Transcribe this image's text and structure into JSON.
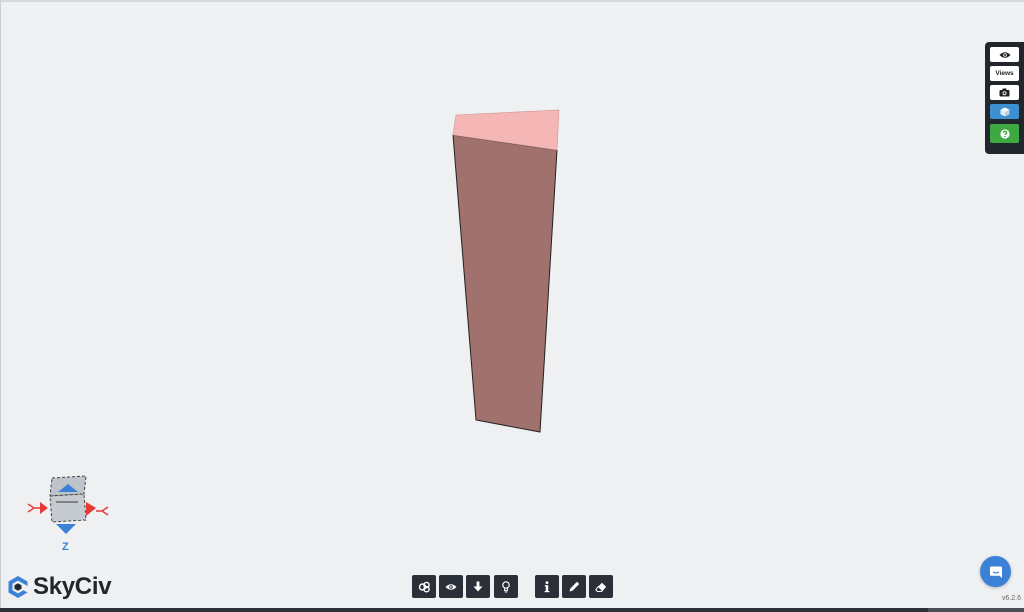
{
  "app": {
    "brand": "SkyCiv",
    "version": "v6.2.6"
  },
  "right_toolbar": {
    "items": [
      {
        "icon": "eye-icon",
        "label": ""
      },
      {
        "icon": "",
        "label": "Views"
      },
      {
        "icon": "camera-icon",
        "label": ""
      },
      {
        "icon": "cube-icon",
        "label": ""
      },
      {
        "icon": "help-icon",
        "label": ""
      }
    ]
  },
  "bottom_toolbar": {
    "items": [
      {
        "icon": "render-settings-icon"
      },
      {
        "icon": "visibility-icon"
      },
      {
        "icon": "arrow-down-icon"
      },
      {
        "icon": "lightbulb-icon"
      },
      {
        "icon": "info-icon"
      },
      {
        "icon": "pencil-icon"
      },
      {
        "icon": "eraser-icon"
      }
    ]
  },
  "gizmo": {
    "axis_label": "Z"
  },
  "colors": {
    "background": "#eef0f2",
    "dark": "#22272d",
    "accent_blue": "#3d8fd1",
    "help_green": "#3ea843",
    "member_side": "#a0716d",
    "member_top": "#f4b7b6"
  }
}
